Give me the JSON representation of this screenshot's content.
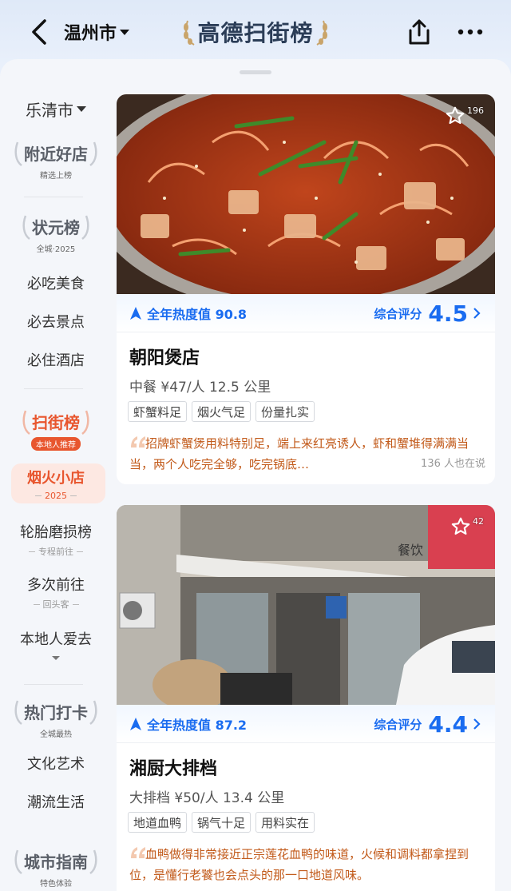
{
  "header": {
    "city": "温州市",
    "brand_title": "高德扫街榜"
  },
  "sidebar": {
    "district": "乐清市",
    "nearby": {
      "title": "附近好店",
      "sub": "精选上榜"
    },
    "champion": {
      "title": "状元榜",
      "sub": "全城·2025"
    },
    "champion_items": [
      "必吃美食",
      "必去景点",
      "必住酒店"
    ],
    "sweep": {
      "title": "扫街榜",
      "sub": "本地人推荐"
    },
    "active_item": {
      "label": "烟火小店",
      "sub": "2025"
    },
    "items_with_sub": [
      {
        "label": "轮胎磨损榜",
        "sub": "专程前往"
      },
      {
        "label": "多次前往",
        "sub": "回头客"
      }
    ],
    "local_love": "本地人爱去",
    "hot": {
      "title": "热门打卡",
      "sub": "全城最热"
    },
    "hot_items": [
      "文化艺术",
      "潮流生活"
    ],
    "guide": {
      "title": "城市指南",
      "sub": "特色体验"
    }
  },
  "cards": [
    {
      "fav_count": "196",
      "heat_label": "全年热度值 90.8",
      "score_label": "综合评分",
      "score": "4.5",
      "name": "朝阳煲店",
      "meta": "中餐  ¥47/人  12.5 公里",
      "tags": [
        "虾蟹料足",
        "烟火气足",
        "份量扎实"
      ],
      "review": "招牌虾蟹煲用料特别足，端上来红亮诱人，虾和蟹堆得满满当当，两个人吃完全够，吃完锅底…",
      "review_count": "136 人也在说"
    },
    {
      "fav_count": "42",
      "heat_label": "全年热度值 87.2",
      "score_label": "综合评分",
      "score": "4.4",
      "name": "湘厨大排档",
      "meta": "大排档  ¥50/人  13.4 公里",
      "tags": [
        "地道血鸭",
        "锅气十足",
        "用料实在"
      ],
      "review": "血鸭做得非常接近正宗莲花血鸭的味道，火候和调料都拿捏到位，是懂行老饕也会点头的那一口地道风味。",
      "review_count": ""
    }
  ],
  "colors": {
    "accent_blue": "#1a6cf0",
    "review_orange": "#c25a1a",
    "active_red": "#e8562e"
  },
  "store_sign": "餐饮"
}
